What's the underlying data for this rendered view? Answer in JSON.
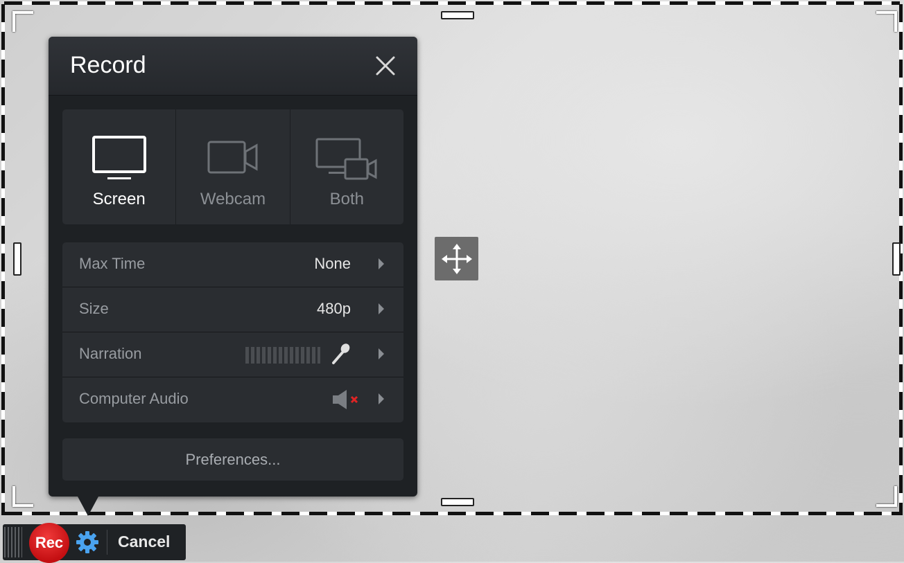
{
  "panel": {
    "title": "Record",
    "close_icon": "close-icon"
  },
  "modes": [
    {
      "label": "Screen",
      "icon": "monitor-icon",
      "active": true
    },
    {
      "label": "Webcam",
      "icon": "webcam-icon",
      "active": false
    },
    {
      "label": "Both",
      "icon": "screen-and-webcam-icon",
      "active": false
    }
  ],
  "settings": [
    {
      "label": "Max Time",
      "value": "None"
    },
    {
      "label": "Size",
      "value": "480p"
    },
    {
      "label": "Narration",
      "value": "",
      "icon": "microphone-icon"
    },
    {
      "label": "Computer Audio",
      "value": "",
      "icon": "speaker-muted-icon"
    }
  ],
  "preferences_label": "Preferences...",
  "toolbar": {
    "rec_label": "Rec",
    "cancel_label": "Cancel"
  },
  "colors": {
    "panel_bg": "#1e2124",
    "row_bg": "#2a2d31",
    "rec_red": "#d91f22",
    "gear_blue": "#4aa3f0"
  }
}
